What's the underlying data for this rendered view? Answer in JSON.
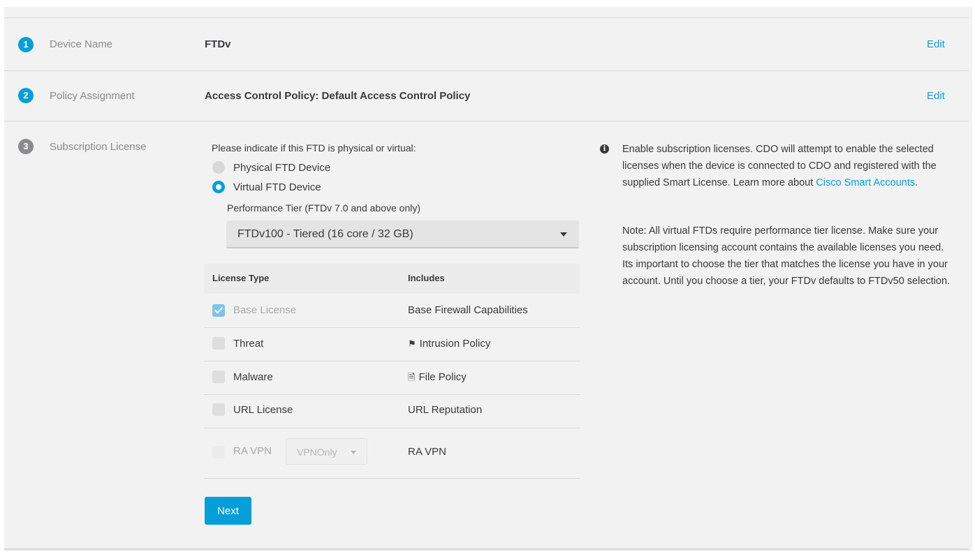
{
  "steps": [
    {
      "number": "1",
      "label": "Device Name",
      "value": "FTDv",
      "edit": "Edit"
    },
    {
      "number": "2",
      "label": "Policy Assignment",
      "value": "Access Control Policy: Default Access Control Policy",
      "edit": "Edit"
    },
    {
      "number": "3",
      "label": "Subscription License"
    }
  ],
  "license_form": {
    "prompt": "Please indicate if this FTD is physical or virtual:",
    "options": [
      {
        "label": "Physical FTD Device",
        "selected": false
      },
      {
        "label": "Virtual FTD Device",
        "selected": true
      }
    ],
    "tier_label": "Performance Tier (FTDv 7.0 and above only)",
    "tier_value": "FTDv100 - Tiered (16 core / 32 GB)",
    "table": {
      "headers": [
        "License Type",
        "Includes"
      ],
      "rows": [
        {
          "license": "Base License",
          "includes": "Base Firewall Capabilities",
          "checked": true,
          "disabled": true
        },
        {
          "license": "Threat",
          "includes": "Intrusion Policy",
          "icon": "intrusion-policy-icon",
          "checked": false
        },
        {
          "license": "Malware",
          "includes": "File Policy",
          "icon": "file-policy-icon",
          "checked": false
        },
        {
          "license": "URL License",
          "includes": "URL Reputation",
          "checked": false
        },
        {
          "license": "RA VPN",
          "includes": "RA VPN",
          "checked": false,
          "disabled": true,
          "select_value": "VPNOnly"
        }
      ]
    },
    "next_label": "Next"
  },
  "info": {
    "p1_text": "Enable subscription licenses. CDO will attempt to enable the selected licenses when the device is connected to CDO and registered with the supplied Smart License. Learn more about ",
    "p1_link": "Cisco Smart Accounts",
    "p1_end": ".",
    "p2": "Note: All virtual FTDs require performance tier license. Make sure your subscription licensing account contains the available licenses you need. Its important to choose the tier that matches the license you have in your account. Until you choose a tier, your FTDv defaults to FTDv50 selection."
  },
  "colors": {
    "accent": "#049fd9",
    "panel": "#f2f2f2",
    "text": "#39393b",
    "muted": "#8a8a8c"
  }
}
